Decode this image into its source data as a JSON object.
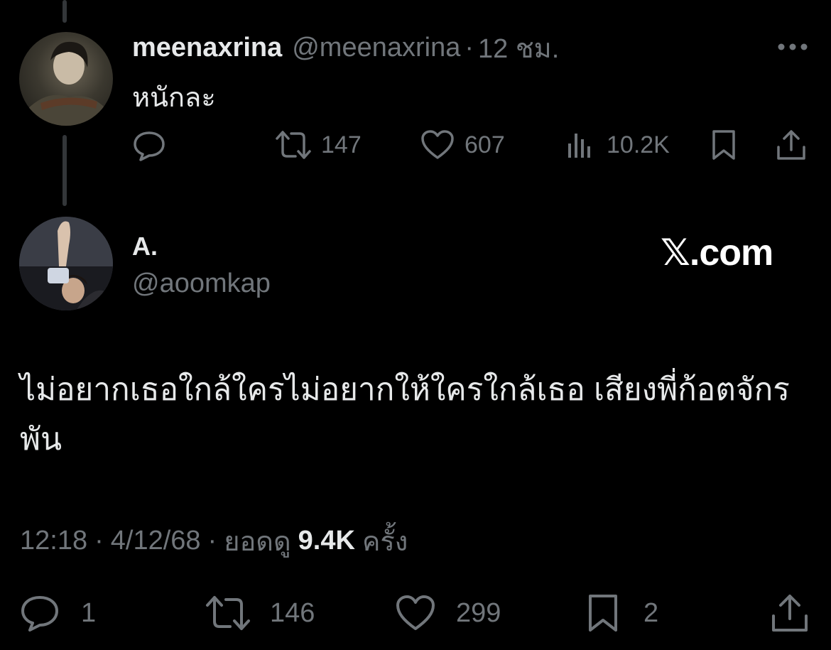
{
  "parent_tweet": {
    "display_name": "meenaxrina",
    "handle": "@meenaxrina",
    "separator": "·",
    "time": "12 ชม.",
    "text": "หนักละ",
    "more_icon": "more-horizontal-icon",
    "actions": {
      "reply_count": "",
      "retweet_count": "147",
      "like_count": "607",
      "views_count": "10.2K"
    }
  },
  "main_tweet": {
    "display_name": "A.",
    "handle": "@aoomkap",
    "brand": "𝕏.com",
    "text": "ไม่อยากเธอใกล้ใครไม่อยากให้ใครใกล้เธอ เสียงพี่ก้อตจักรพัน",
    "meta": {
      "time": "12:18",
      "sep1": "·",
      "date": "4/12/68",
      "sep2": "·",
      "views_prefix": "ยอดดู",
      "views_count": "9.4K",
      "views_suffix": "ครั้ง"
    },
    "actions": {
      "reply_count": "1",
      "retweet_count": "146",
      "like_count": "299",
      "bookmark_count": "2"
    }
  },
  "colors": {
    "background": "#000000",
    "text_primary": "#e7e9ea",
    "text_muted": "#71767b",
    "thread_line": "#333639"
  }
}
